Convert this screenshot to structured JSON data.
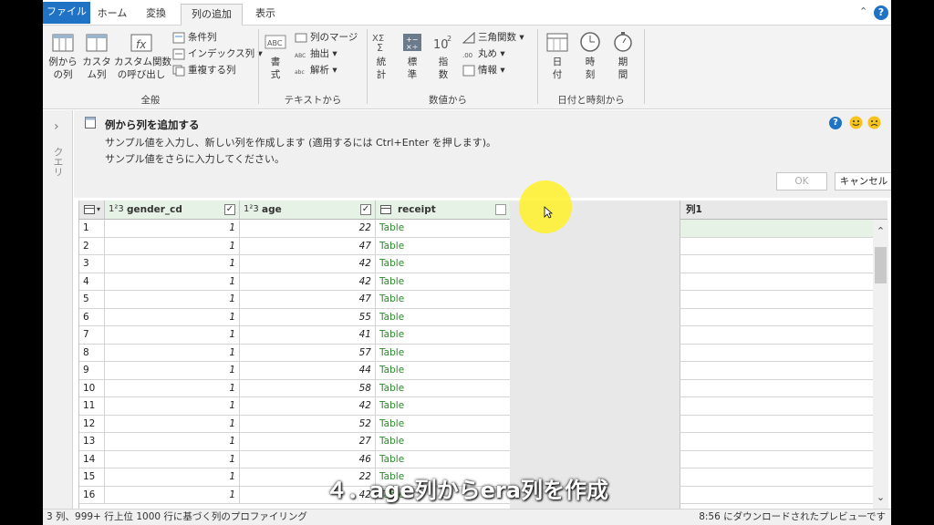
{
  "ribbon_tabs": [
    "ファイル",
    "ホーム",
    "変換",
    "列の追加",
    "表示"
  ],
  "active_tab": "列の追加",
  "ribbon": {
    "general": {
      "example_col": "例から\nの列",
      "custom_col": "カスタ\nム列",
      "custom_func": "カスタム関数\nの呼び出し",
      "conditional": "条件列",
      "index_col": "インデックス列",
      "duplicate": "重複する列",
      "label": "全般"
    },
    "text": {
      "format": "書\n式",
      "merge": "列のマージ",
      "extract": "抽出",
      "parse": "解析",
      "label": "テキストから"
    },
    "number": {
      "statistics": "統\n計",
      "standard": "標\n準",
      "scientific": "指\n数",
      "trig": "三角関数",
      "rounding": "丸め",
      "info": "情報",
      "label": "数値から"
    },
    "datetime": {
      "date": "日\n付",
      "time": "時\n刻",
      "duration": "期\n間",
      "label": "日付と時刻から"
    }
  },
  "queries_pane": {
    "label": "クエリ"
  },
  "example_pane": {
    "title": "例から列を追加する",
    "desc1": "サンプル値を入力し、新しい列を作成します (適用するには Ctrl+Enter を押します)。",
    "desc2": "サンプル値をさらに入力してください。",
    "ok": "OK",
    "cancel": "キャンセル"
  },
  "grid": {
    "type_numeric": "1²3",
    "columns": [
      {
        "name": "gender_cd",
        "type": "1²3"
      },
      {
        "name": "age",
        "type": "1²3"
      },
      {
        "name": "receipt",
        "type": "table"
      }
    ],
    "rows": [
      {
        "idx": "1",
        "gender_cd": "1",
        "age": "22",
        "receipt": "Table"
      },
      {
        "idx": "2",
        "gender_cd": "1",
        "age": "47",
        "receipt": "Table"
      },
      {
        "idx": "3",
        "gender_cd": "1",
        "age": "42",
        "receipt": "Table"
      },
      {
        "idx": "4",
        "gender_cd": "1",
        "age": "42",
        "receipt": "Table"
      },
      {
        "idx": "5",
        "gender_cd": "1",
        "age": "47",
        "receipt": "Table"
      },
      {
        "idx": "6",
        "gender_cd": "1",
        "age": "55",
        "receipt": "Table"
      },
      {
        "idx": "7",
        "gender_cd": "1",
        "age": "41",
        "receipt": "Table"
      },
      {
        "idx": "8",
        "gender_cd": "1",
        "age": "57",
        "receipt": "Table"
      },
      {
        "idx": "9",
        "gender_cd": "1",
        "age": "44",
        "receipt": "Table"
      },
      {
        "idx": "10",
        "gender_cd": "1",
        "age": "58",
        "receipt": "Table"
      },
      {
        "idx": "11",
        "gender_cd": "1",
        "age": "42",
        "receipt": "Table"
      },
      {
        "idx": "12",
        "gender_cd": "1",
        "age": "52",
        "receipt": "Table"
      },
      {
        "idx": "13",
        "gender_cd": "1",
        "age": "27",
        "receipt": "Table"
      },
      {
        "idx": "14",
        "gender_cd": "1",
        "age": "46",
        "receipt": "Table"
      },
      {
        "idx": "15",
        "gender_cd": "1",
        "age": "22",
        "receipt": "Table"
      },
      {
        "idx": "16",
        "gender_cd": "1",
        "age": "42",
        "receipt": "Table"
      }
    ]
  },
  "example_column": {
    "header": "列1"
  },
  "statusbar": {
    "counts": "3 列、999+ 行",
    "profiling": "上位 1000 行に基づく列のプロファイリング",
    "download": "8:56 にダウンロードされたプレビューです"
  },
  "subtitle": "４．age列からera列を作成",
  "colors": {
    "accent": "#1f72c4",
    "header_green": "#e6f2e6",
    "table_text": "#2a8a2a",
    "highlight": "#fff028"
  }
}
